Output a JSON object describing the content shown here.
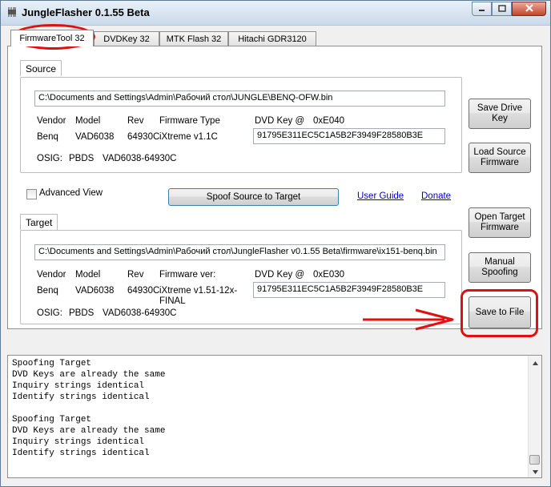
{
  "window": {
    "title": "JungleFlasher 0.1.55 Beta"
  },
  "tabs": [
    {
      "label": "FirmwareTool 32"
    },
    {
      "label": "DVDKey 32"
    },
    {
      "label": "MTK Flash 32"
    },
    {
      "label": "Hitachi GDR3120"
    }
  ],
  "source": {
    "label": "Source",
    "path": "C:\\Documents and Settings\\Admin\\Рабочий стол\\JUNGLE\\BENQ-OFW.bin",
    "headers": {
      "vendor": "Vendor",
      "model": "Model",
      "rev": "Rev",
      "fw": "Firmware Type",
      "dvdkey": "DVD Key @",
      "dvdkey_addr": "0xE040"
    },
    "values": {
      "vendor": "Benq",
      "model": "VAD6038",
      "rev": "64930C",
      "fw": "iXtreme v1.1C"
    },
    "key": "91795E311EC5C1A5B2F3949F28580B3E",
    "osig_label": "OSIG:",
    "osig_vendor": "PBDS",
    "osig_model": "VAD6038-64930C"
  },
  "middle": {
    "advanced_view": "Advanced View",
    "spoof_button": "Spoof Source to Target",
    "user_guide": "User Guide",
    "donate": "Donate"
  },
  "target": {
    "label": "Target",
    "path": "C:\\Documents and Settings\\Admin\\Рабочий стол\\JungleFlasher v0.1.55 Beta\\firmware\\ix151-benq.bin",
    "headers": {
      "vendor": "Vendor",
      "model": "Model",
      "rev": "Rev",
      "fw": "Firmware ver:",
      "dvdkey": "DVD Key @",
      "dvdkey_addr": "0xE030"
    },
    "values": {
      "vendor": "Benq",
      "model": "VAD6038",
      "rev": "64930C",
      "fw1": "iXtreme v1.51-12x-",
      "fw2": "FINAL"
    },
    "key": "91795E311EC5C1A5B2F3949F28580B3E",
    "osig_label": "OSIG:",
    "osig_vendor": "PBDS",
    "osig_model": "VAD6038-64930C"
  },
  "side_buttons": {
    "save_drive_key": "Save Drive Key",
    "load_source_1": "Load Source",
    "load_source_2": "Firmware",
    "open_target_1": "Open Target",
    "open_target_2": "Firmware",
    "manual_1": "Manual",
    "manual_2": "Spoofing",
    "save_to_file": "Save to File"
  },
  "log": [
    "Spoofing Target",
    "DVD Keys are already the same",
    "Inquiry strings identical",
    "Identify strings identical",
    "",
    "Spoofing Target",
    "DVD Keys are already the same",
    "Inquiry strings identical",
    "Identify strings identical"
  ],
  "colors": {
    "highlight": "#e01010",
    "link": "#0000cc",
    "accent": "#3c7fb1"
  }
}
